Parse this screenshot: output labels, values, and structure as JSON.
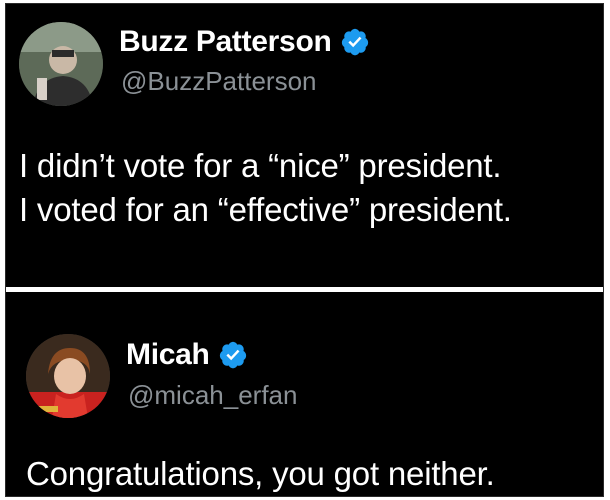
{
  "tweets": [
    {
      "name": "Buzz Patterson",
      "handle": "@BuzzPatterson",
      "verified_icon": "verified-badge-icon",
      "text_lines": [
        "I didn’t vote for a “nice” president.",
        "I voted for an “effective” president."
      ]
    },
    {
      "name": "Micah",
      "handle": "@micah_erfan",
      "verified_icon": "verified-badge-icon",
      "text_lines": [
        "Congratulations, you got neither."
      ]
    }
  ],
  "colors": {
    "background": "#000000",
    "text": "#ffffff",
    "handle": "#8b9196",
    "verified": "#1d9bf0",
    "divider": "#ffffff"
  }
}
